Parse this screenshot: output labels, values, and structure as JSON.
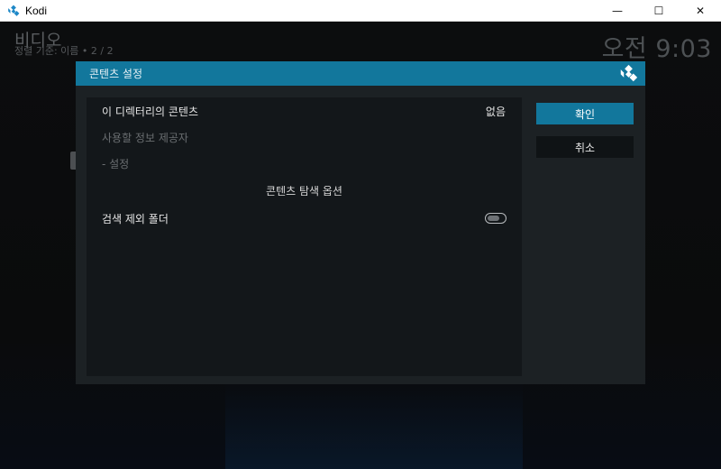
{
  "window": {
    "title": "Kodi",
    "controls": {
      "minimize": "—",
      "maximize": "☐",
      "close": "✕"
    }
  },
  "background": {
    "title": "비디오",
    "subtitle": "정렬 기준: 이름  •  2 / 2",
    "clock": "오전 9:03"
  },
  "dialog": {
    "title": "콘텐츠 설정",
    "rows": [
      {
        "label": "이 디렉터리의 콘텐츠",
        "value": "없음"
      },
      {
        "label": "사용할 정보 제공자"
      },
      {
        "label": "- 설정"
      }
    ],
    "section_header": "콘텐츠 탐색 옵션",
    "toggle_row": {
      "label": "검색 제외 폴더",
      "state": "off"
    },
    "buttons": {
      "ok": "확인",
      "cancel": "취소"
    }
  },
  "colors": {
    "accent": "#12779c",
    "dialog_bg": "#1c2124",
    "panel_bg": "#13171a",
    "app_icon": "#1e88c7"
  },
  "icons": {
    "app": "kodi-logo-icon",
    "dialog_header": "kodi-logo-icon"
  }
}
